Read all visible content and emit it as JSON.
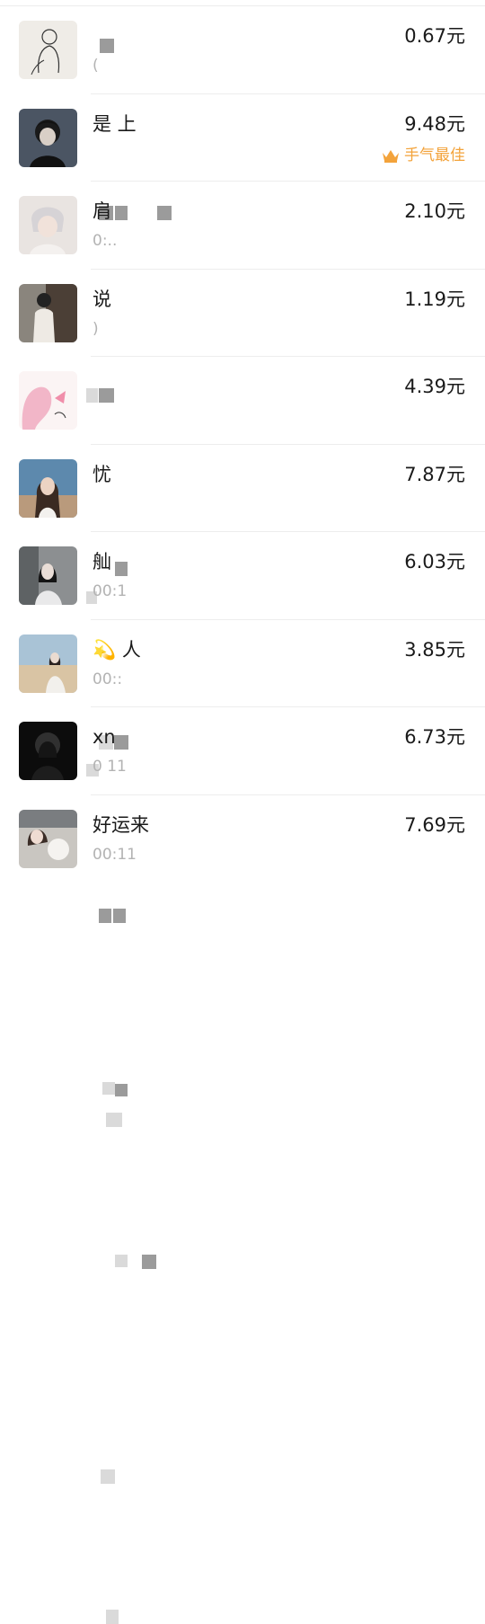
{
  "records": [
    {
      "name": "",
      "time": "(",
      "amount": "0.67元",
      "best": ""
    },
    {
      "name": "是 上",
      "time": "",
      "amount": "9.48元",
      "best": "手气最佳"
    },
    {
      "name": "肩",
      "time": "0:..",
      "amount": "2.10元",
      "best": ""
    },
    {
      "name": "说",
      "time": ")",
      "amount": "1.19元",
      "best": ""
    },
    {
      "name": "",
      "time": "",
      "amount": "4.39元",
      "best": ""
    },
    {
      "name": "忧",
      "time": "",
      "amount": "7.87元",
      "best": ""
    },
    {
      "name": "舢",
      "time": "00:1",
      "amount": "6.03元",
      "best": ""
    },
    {
      "name": "💫  人",
      "time": "00::",
      "amount": "3.85元",
      "best": ""
    },
    {
      "name": "xn",
      "time": "0 11",
      "amount": "6.73元",
      "best": ""
    },
    {
      "name": "好运来",
      "time": "00:11",
      "amount": "7.69元",
      "best": ""
    }
  ],
  "icons": {
    "best_luck": "crown-icon"
  },
  "colors": {
    "best_luck": "#f3a33b",
    "time_text": "#b3b3b3",
    "amount_text": "#1a1a1a"
  }
}
